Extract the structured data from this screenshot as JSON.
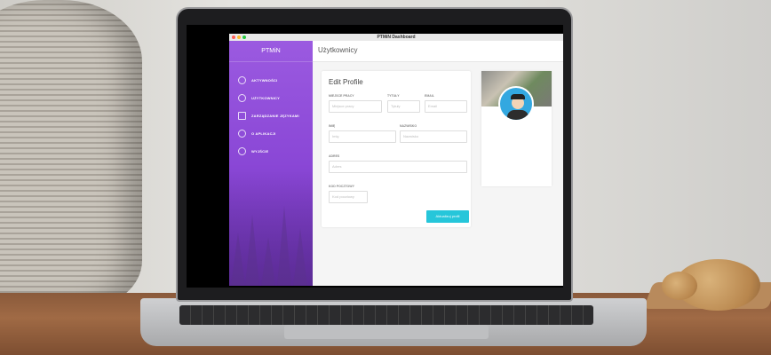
{
  "window": {
    "title": "PTMiN Dashboard"
  },
  "sidebar": {
    "brand": "PTMiN",
    "items": [
      {
        "label": "AKTYWNOŚCI",
        "icon": "pie-chart-icon"
      },
      {
        "label": "UŻYTKOWNICY",
        "icon": "globe-icon"
      },
      {
        "label": "ZARZĄDZANIE JĘZYKAMI",
        "icon": "document-icon"
      },
      {
        "label": "O APLIKACJI",
        "icon": "location-pin-icon"
      },
      {
        "label": "WYJŚCIE",
        "icon": "gear-icon"
      }
    ]
  },
  "header": {
    "title": "Użytkownicy"
  },
  "form": {
    "title": "Edit Profile",
    "fields": {
      "workplace": {
        "label": "MIEJSCE PRACY",
        "placeholder": "Miejsce pracy"
      },
      "titles": {
        "label": "TYTUŁY",
        "placeholder": "Tytuły"
      },
      "email": {
        "label": "EMAIL",
        "placeholder": "Email"
      },
      "first_name": {
        "label": "IMIĘ",
        "placeholder": "Imię"
      },
      "last_name": {
        "label": "NAZWISKO",
        "placeholder": "Nazwisko"
      },
      "address": {
        "label": "ADRES",
        "placeholder": "Adres"
      },
      "postal": {
        "label": "KOD POCZTOWY",
        "placeholder": "Kod pocztowy"
      }
    },
    "submit_label": "Aktualizuj profil"
  },
  "colors": {
    "sidebar": "#8a47d6",
    "button": "#26c6da",
    "avatar_bg": "#33a8e0"
  }
}
